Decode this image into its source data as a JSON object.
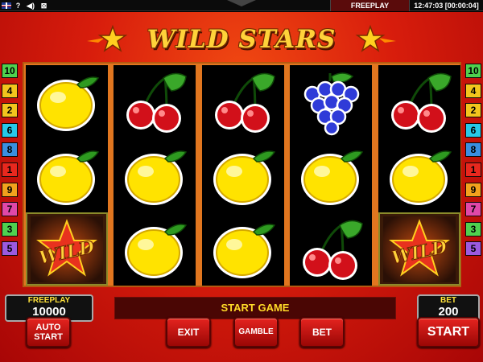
{
  "topbar": {
    "help_label": "?",
    "sound_label": "◀)",
    "quit_label": "⊠",
    "mode_label": "FREEPLAY",
    "clock": "12:47:03 [00:00:04]"
  },
  "game": {
    "logo": "WILD STARS"
  },
  "lines": {
    "left": [
      {
        "label": "10",
        "color": "#4fd14f"
      },
      {
        "label": "4",
        "color": "#f2c51d"
      },
      {
        "label": "2",
        "color": "#f2c51d"
      },
      {
        "label": "6",
        "color": "#27c9e8"
      },
      {
        "label": "8",
        "color": "#3a8fe0"
      },
      {
        "label": "1",
        "color": "#e8281e"
      },
      {
        "label": "9",
        "color": "#f2a21d"
      },
      {
        "label": "7",
        "color": "#e048a8"
      },
      {
        "label": "3",
        "color": "#4fd14f"
      },
      {
        "label": "5",
        "color": "#9b5ae0"
      }
    ],
    "right": [
      {
        "label": "10",
        "color": "#4fd14f"
      },
      {
        "label": "4",
        "color": "#f2c51d"
      },
      {
        "label": "2",
        "color": "#f2c51d"
      },
      {
        "label": "6",
        "color": "#27c9e8"
      },
      {
        "label": "8",
        "color": "#3a8fe0"
      },
      {
        "label": "1",
        "color": "#e8281e"
      },
      {
        "label": "9",
        "color": "#f2a21d"
      },
      {
        "label": "7",
        "color": "#e048a8"
      },
      {
        "label": "3",
        "color": "#4fd14f"
      },
      {
        "label": "5",
        "color": "#9b5ae0"
      }
    ]
  },
  "reels": [
    [
      "lemon",
      "lemon",
      "wild"
    ],
    [
      "cherry",
      "lemon",
      "lemon"
    ],
    [
      "cherry",
      "lemon",
      "lemon"
    ],
    [
      "grapes",
      "lemon",
      "cherry"
    ],
    [
      "cherry",
      "lemon",
      "wild"
    ]
  ],
  "panel": {
    "freeplay_caption": "FREEPLAY",
    "freeplay_value": "10000",
    "status_message": "START GAME",
    "bet_caption": "BET",
    "bet_value": "200"
  },
  "buttons": {
    "auto_line1": "AUTO",
    "auto_line2": "START",
    "exit": "EXIT",
    "gamble": "GAMBLE",
    "bet": "BET",
    "start": "START"
  },
  "wild_label": "WILD"
}
